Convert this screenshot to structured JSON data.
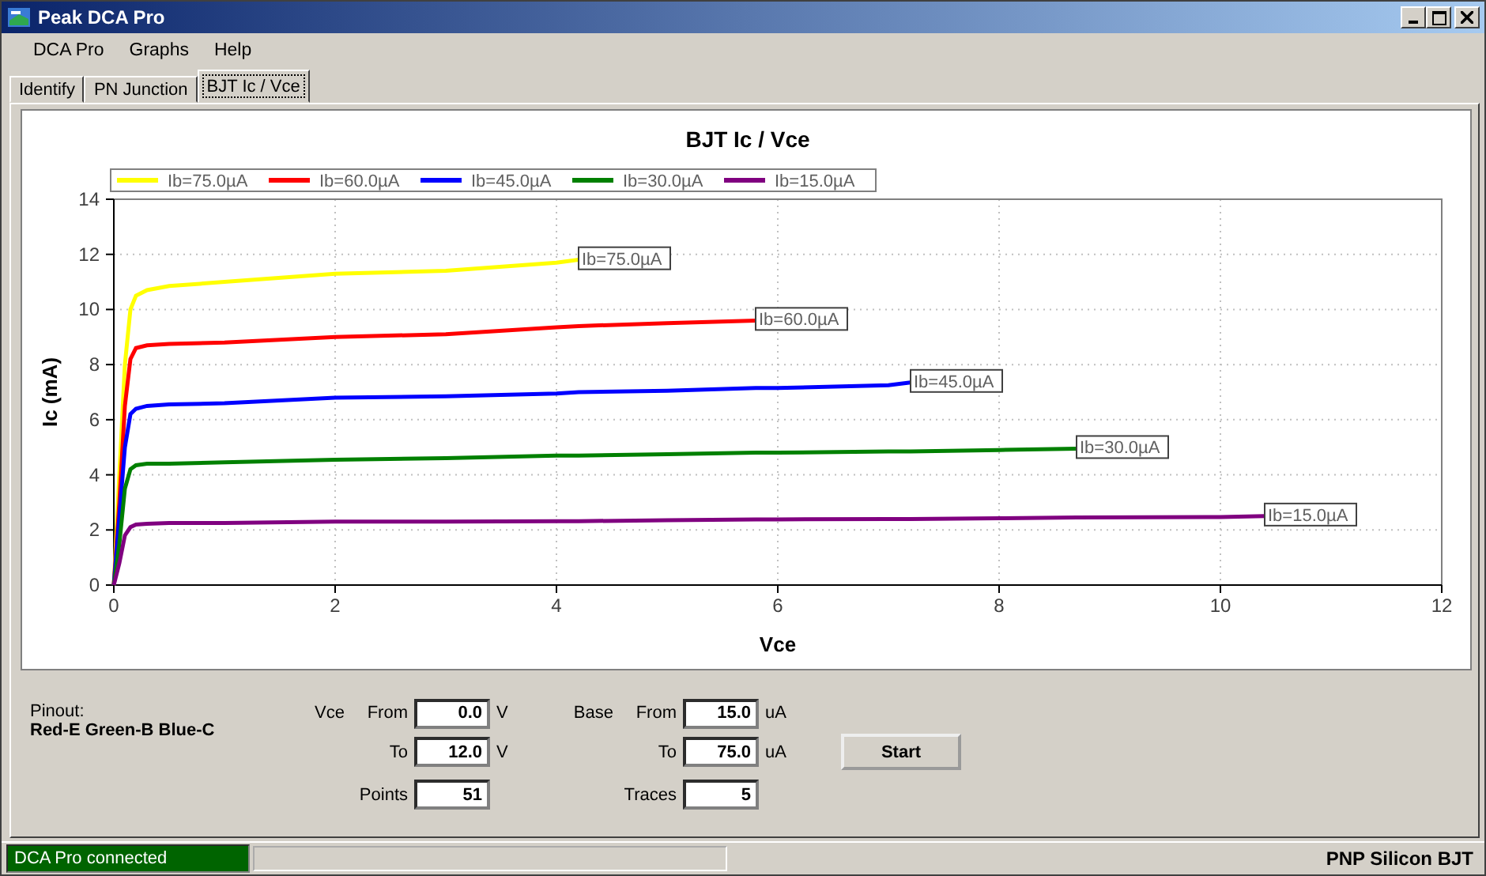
{
  "window": {
    "title": "Peak DCA Pro"
  },
  "menu": [
    "DCA Pro",
    "Graphs",
    "Help"
  ],
  "tabs": [
    {
      "label": "Identify",
      "selected": false
    },
    {
      "label": "PN Junction",
      "selected": false
    },
    {
      "label": "BJT Ic / Vce",
      "selected": true
    }
  ],
  "chart_data": {
    "type": "line",
    "title": "BJT Ic / Vce",
    "xlabel": "Vce",
    "ylabel": "Ic (mA)",
    "x": [
      0,
      0.05,
      0.1,
      0.15,
      0.2,
      0.3,
      0.5,
      1,
      2,
      3,
      4,
      4.2,
      5,
      5.8,
      6,
      7,
      7.2,
      8,
      8.7,
      10,
      10.4
    ],
    "series": [
      {
        "name": "Ib=75.0µA",
        "color": "#ffff00",
        "values": [
          0,
          4,
          8,
          10,
          10.5,
          10.7,
          10.85,
          11.0,
          11.3,
          11.4,
          11.7,
          11.8,
          null,
          null,
          null,
          null,
          null,
          null,
          null,
          null,
          null
        ]
      },
      {
        "name": "Ib=60.0µA",
        "color": "#ff0000",
        "values": [
          0,
          3,
          6.5,
          8.2,
          8.6,
          8.7,
          8.75,
          8.8,
          9.0,
          9.1,
          9.35,
          9.4,
          9.5,
          9.6,
          null,
          null,
          null,
          null,
          null,
          null,
          null
        ]
      },
      {
        "name": "Ib=45.0µA",
        "color": "#0000ff",
        "values": [
          0,
          2.5,
          5,
          6.2,
          6.4,
          6.5,
          6.55,
          6.6,
          6.8,
          6.85,
          6.95,
          7.0,
          7.05,
          7.15,
          7.15,
          7.25,
          7.35,
          null,
          null,
          null,
          null
        ]
      },
      {
        "name": "Ib=30.0µA",
        "color": "#008000",
        "values": [
          0,
          1.5,
          3.5,
          4.2,
          4.35,
          4.4,
          4.4,
          4.45,
          4.55,
          4.6,
          4.7,
          4.7,
          4.75,
          4.8,
          4.8,
          4.85,
          4.85,
          4.9,
          4.95,
          null,
          null
        ]
      },
      {
        "name": "Ib=15.0µA",
        "color": "#800080",
        "values": [
          0,
          0.8,
          1.8,
          2.1,
          2.2,
          2.22,
          2.25,
          2.25,
          2.3,
          2.3,
          2.32,
          2.32,
          2.35,
          2.38,
          2.38,
          2.4,
          2.4,
          2.42,
          2.45,
          2.47,
          2.5
        ]
      }
    ],
    "grid": true,
    "legend": "top",
    "xlim": [
      0,
      12
    ],
    "ylim": [
      0,
      14
    ],
    "xticks": [
      0,
      2,
      4,
      6,
      8,
      10,
      12
    ],
    "yticks": [
      0,
      2,
      4,
      6,
      8,
      10,
      12,
      14
    ],
    "annotations": [
      {
        "x": 4.2,
        "y": 11.8,
        "text": "Ib=75.0µA"
      },
      {
        "x": 5.8,
        "y": 9.6,
        "text": "Ib=60.0µA"
      },
      {
        "x": 7.2,
        "y": 7.35,
        "text": "Ib=45.0µA"
      },
      {
        "x": 8.7,
        "y": 4.95,
        "text": "Ib=30.0µA"
      },
      {
        "x": 10.4,
        "y": 2.5,
        "text": "Ib=15.0µA"
      }
    ]
  },
  "sweep": {
    "pinout_label": "Pinout:",
    "pinout": "Red-E Green-B Blue-C",
    "groups": [
      {
        "label": "Vce",
        "rows": [
          {
            "label": "From",
            "value": "0.0",
            "unit": "V"
          },
          {
            "label": "To",
            "value": "12.0",
            "unit": "V"
          },
          {
            "label": "Points",
            "value": "51"
          }
        ]
      },
      {
        "label": "Base",
        "rows": [
          {
            "label": "From",
            "value": "15.0",
            "unit": "uA"
          },
          {
            "label": "To",
            "value": "75.0",
            "unit": "uA"
          },
          {
            "label": "Traces",
            "value": "5"
          }
        ]
      }
    ],
    "button": "Start"
  },
  "status_bar": {
    "connection": "DCA Pro connected",
    "progress": {
      "level": 0
    },
    "device": "PNP Silicon BJT"
  }
}
